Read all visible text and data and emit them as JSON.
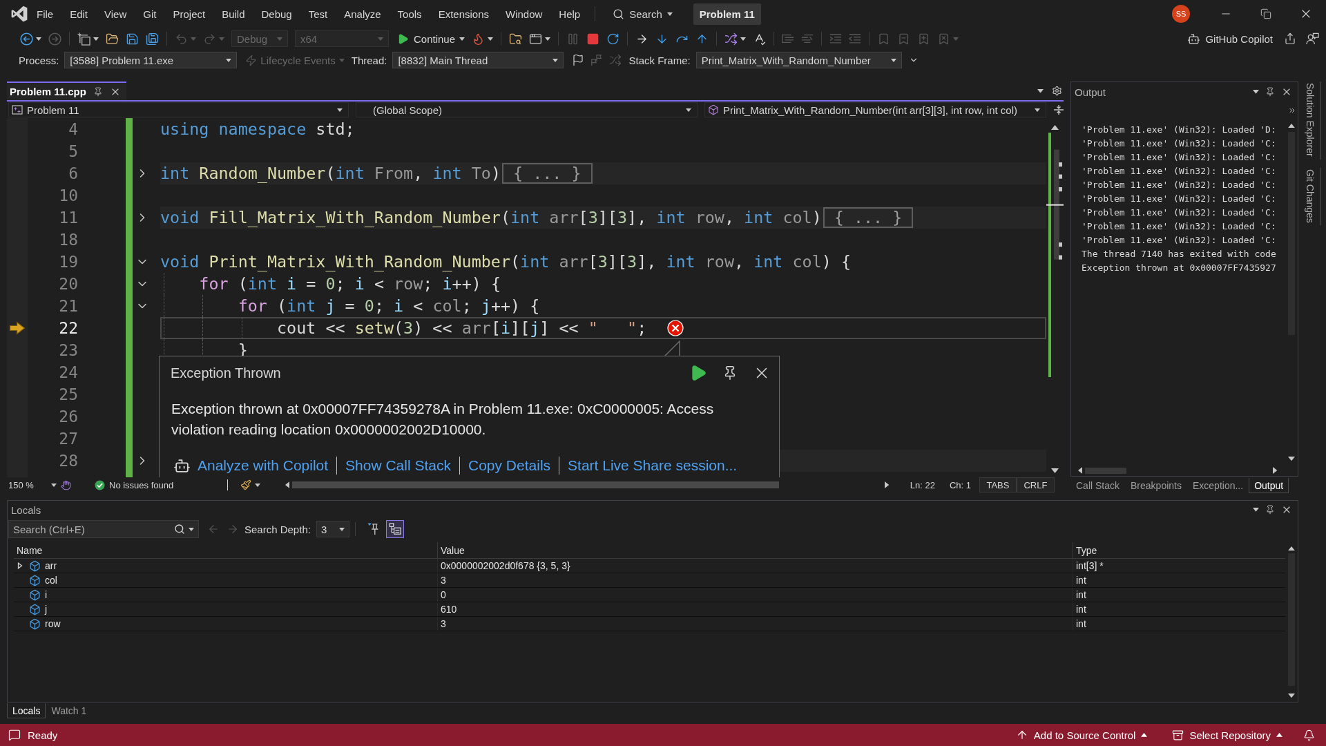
{
  "menu_bar": {
    "items": [
      "File",
      "Edit",
      "View",
      "Git",
      "Project",
      "Build",
      "Debug",
      "Test",
      "Analyze",
      "Tools",
      "Extensions",
      "Window",
      "Help"
    ],
    "search": "Search",
    "solution": "Problem 11",
    "avatar": "SS"
  },
  "toolbar": {
    "groups": [
      [
        {
          "kind": "back",
          "disabled": false
        },
        {
          "kind": "forward",
          "disabled": true
        }
      ],
      [
        {
          "kind": "new-item",
          "disabled": false
        },
        {
          "kind": "open",
          "disabled": false
        },
        {
          "kind": "save",
          "disabled": false
        },
        {
          "kind": "save-all",
          "disabled": false
        }
      ],
      [
        {
          "kind": "undo",
          "disabled": true
        },
        {
          "kind": "redo",
          "disabled": true
        },
        {
          "kind": "combo",
          "value": "Debug",
          "disabled": true
        },
        {
          "kind": "combo",
          "value": "x64",
          "disabled": true
        },
        {
          "kind": "continue",
          "label": "Continue",
          "disabled": false
        },
        {
          "kind": "hot-reload",
          "disabled": false
        }
      ],
      [
        {
          "kind": "folder-search",
          "disabled": false
        },
        {
          "kind": "browser",
          "disabled": false
        }
      ],
      [
        {
          "kind": "pause",
          "disabled": true
        },
        {
          "kind": "stop",
          "disabled": false
        },
        {
          "kind": "restart",
          "disabled": false
        }
      ],
      [
        {
          "kind": "next-statement",
          "disabled": false
        },
        {
          "kind": "step-into",
          "disabled": false
        },
        {
          "kind": "step-over",
          "disabled": false
        },
        {
          "kind": "step-out",
          "disabled": false
        }
      ],
      [
        {
          "kind": "hot-swap",
          "disabled": false
        },
        {
          "kind": "spell-check",
          "disabled": false
        }
      ],
      [
        {
          "kind": "comment",
          "disabled": true
        },
        {
          "kind": "uncomment",
          "disabled": true
        }
      ],
      [
        {
          "kind": "indent",
          "disabled": true
        },
        {
          "kind": "outdent",
          "disabled": true
        }
      ],
      [
        {
          "kind": "bookmark",
          "disabled": true
        },
        {
          "kind": "bookmark-previous",
          "disabled": true
        },
        {
          "kind": "bookmark-next",
          "disabled": true
        },
        {
          "kind": "bookmark-clear",
          "disabled": true
        }
      ]
    ],
    "copilot": "GitHub Copilot"
  },
  "debug_location": {
    "process_label": "Process:",
    "process": "[3588] Problem 11.exe",
    "lifecycle": {
      "label": "Lifecycle Events",
      "disabled": true
    },
    "thread_label": "Thread:",
    "thread": "[8832] Main Thread",
    "thread_tools": [
      {
        "kind": "flag",
        "disabled": false
      },
      {
        "kind": "flag-threads",
        "disabled": true
      },
      {
        "kind": "parallel",
        "disabled": true
      }
    ],
    "stack_frame_label": "Stack Frame:",
    "stack_frame": "Print_Matrix_With_Random_Number"
  },
  "document_tabs": [
    {
      "label": "Problem 11.cpp",
      "selected": true
    }
  ],
  "navigation_bar": {
    "project": "Problem 11",
    "scope": "(Global Scope)",
    "member": "Print_Matrix_With_Random_Number(int arr[3][3], int row, int col)"
  },
  "editor": {
    "lines": [
      {
        "number": "4",
        "kind": "plain",
        "current": false,
        "exception": false,
        "tokens": [
          {
            "kind": "keyword",
            "text": "using "
          },
          {
            "kind": "keyword",
            "text": "namespace"
          },
          {
            "kind": "plain",
            "text": " std;"
          }
        ]
      },
      {
        "number": "5",
        "kind": "plain",
        "current": false,
        "exception": false
      },
      {
        "number": "6",
        "kind": "collapsed",
        "current": false,
        "exception": false,
        "tokens": [
          {
            "kind": "keyword",
            "text": "int "
          },
          {
            "kind": "function",
            "text": "Random_Number"
          },
          {
            "kind": "plain",
            "text": "("
          },
          {
            "kind": "keyword",
            "text": "int "
          },
          {
            "kind": "parameter",
            "text": "From"
          },
          {
            "kind": "plain",
            "text": ", "
          },
          {
            "kind": "keyword",
            "text": "int "
          },
          {
            "kind": "parameter",
            "text": "To"
          },
          {
            "kind": "plain",
            "text": ")"
          }
        ],
        "collapsed_text": "{ ... }"
      },
      {
        "number": "10",
        "kind": "plain",
        "current": false,
        "exception": false
      },
      {
        "number": "11",
        "kind": "collapsed",
        "current": false,
        "exception": false,
        "tokens": [
          {
            "kind": "keyword",
            "text": "void "
          },
          {
            "kind": "function",
            "text": "Fill_Matrix_With_Random_Number"
          },
          {
            "kind": "plain",
            "text": "("
          },
          {
            "kind": "keyword",
            "text": "int "
          },
          {
            "kind": "parameter",
            "text": "arr"
          },
          {
            "kind": "plain",
            "text": "["
          },
          {
            "kind": "number",
            "text": "3"
          },
          {
            "kind": "plain",
            "text": "]["
          },
          {
            "kind": "number",
            "text": "3"
          },
          {
            "kind": "plain",
            "text": "], "
          },
          {
            "kind": "keyword",
            "text": "int "
          },
          {
            "kind": "parameter",
            "text": "row"
          },
          {
            "kind": "plain",
            "text": ", "
          },
          {
            "kind": "keyword",
            "text": "int "
          },
          {
            "kind": "parameter",
            "text": "col"
          },
          {
            "kind": "plain",
            "text": ")"
          }
        ],
        "collapsed_text": "{ ... }"
      },
      {
        "number": "18",
        "kind": "plain",
        "current": false,
        "exception": false
      },
      {
        "number": "19",
        "kind": "expanded",
        "current": false,
        "exception": false,
        "tokens": [
          {
            "kind": "keyword",
            "text": "void "
          },
          {
            "kind": "function",
            "text": "Print_Matrix_With_Random_Number"
          },
          {
            "kind": "plain",
            "text": "("
          },
          {
            "kind": "keyword",
            "text": "int "
          },
          {
            "kind": "parameter",
            "text": "arr"
          },
          {
            "kind": "plain",
            "text": "["
          },
          {
            "kind": "number",
            "text": "3"
          },
          {
            "kind": "plain",
            "text": "]["
          },
          {
            "kind": "number",
            "text": "3"
          },
          {
            "kind": "plain",
            "text": "], "
          },
          {
            "kind": "keyword",
            "text": "int "
          },
          {
            "kind": "parameter",
            "text": "row"
          },
          {
            "kind": "plain",
            "text": ", "
          },
          {
            "kind": "keyword",
            "text": "int "
          },
          {
            "kind": "parameter",
            "text": "col"
          },
          {
            "kind": "plain",
            "text": ") {"
          }
        ]
      },
      {
        "number": "20",
        "kind": "expanded",
        "current": false,
        "exception": false,
        "tokens": [
          {
            "kind": "control",
            "text": "\tfor"
          },
          {
            "kind": "plain",
            "text": " ("
          },
          {
            "kind": "keyword",
            "text": "int "
          },
          {
            "kind": "local",
            "text": "i"
          },
          {
            "kind": "plain",
            "text": " = "
          },
          {
            "kind": "number",
            "text": "0"
          },
          {
            "kind": "plain",
            "text": "; "
          },
          {
            "kind": "local",
            "text": "i"
          },
          {
            "kind": "plain",
            "text": " < "
          },
          {
            "kind": "parameter",
            "text": "row"
          },
          {
            "kind": "plain",
            "text": "; "
          },
          {
            "kind": "local",
            "text": "i"
          },
          {
            "kind": "plain",
            "text": "++) {"
          }
        ]
      },
      {
        "number": "21",
        "kind": "expanded",
        "current": false,
        "exception": false,
        "tokens": [
          {
            "kind": "control",
            "text": "\t\tfor"
          },
          {
            "kind": "plain",
            "text": " ("
          },
          {
            "kind": "keyword",
            "text": "int "
          },
          {
            "kind": "local",
            "text": "j"
          },
          {
            "kind": "plain",
            "text": " = "
          },
          {
            "kind": "number",
            "text": "0"
          },
          {
            "kind": "plain",
            "text": "; "
          },
          {
            "kind": "local",
            "text": "i"
          },
          {
            "kind": "plain",
            "text": " < "
          },
          {
            "kind": "parameter",
            "text": "col"
          },
          {
            "kind": "plain",
            "text": "; "
          },
          {
            "kind": "local",
            "text": "j"
          },
          {
            "kind": "plain",
            "text": "++) {"
          }
        ]
      },
      {
        "number": "22",
        "kind": "plain",
        "current": true,
        "exception": true,
        "tokens": [
          {
            "kind": "plain",
            "text": "\t\t\tcout << "
          },
          {
            "kind": "function",
            "text": "setw"
          },
          {
            "kind": "plain",
            "text": "("
          },
          {
            "kind": "number",
            "text": "3"
          },
          {
            "kind": "plain",
            "text": ") << "
          },
          {
            "kind": "parameter",
            "text": "arr"
          },
          {
            "kind": "plain",
            "text": "["
          },
          {
            "kind": "local",
            "text": "i"
          },
          {
            "kind": "plain",
            "text": "]["
          },
          {
            "kind": "local",
            "text": "j"
          },
          {
            "kind": "plain",
            "text": "] << "
          },
          {
            "kind": "string",
            "text": "\"   \""
          },
          {
            "kind": "plain",
            "text": ";"
          }
        ]
      },
      {
        "number": "23",
        "kind": "plain",
        "current": false,
        "exception": false,
        "tokens": [
          {
            "kind": "plain",
            "text": "\t\t}"
          }
        ]
      },
      {
        "number": "24",
        "kind": "plain",
        "current": false,
        "exception": false
      },
      {
        "number": "25",
        "kind": "plain",
        "current": false,
        "exception": false
      },
      {
        "number": "26",
        "kind": "plain",
        "current": false,
        "exception": false
      },
      {
        "number": "27",
        "kind": "plain",
        "current": false,
        "exception": false
      },
      {
        "number": "28",
        "kind": "collapsed",
        "current": false,
        "exception": false
      }
    ],
    "exception_popup": {
      "title": "Exception Thrown",
      "message": "Exception thrown at 0x00007FF74359278A in Problem 11.exe: 0xC0000005: Access violation reading location 0x0000002002D10000.",
      "links": [
        {
          "kind": "copilot",
          "label": "Analyze with Copilot"
        },
        {
          "kind": "link",
          "label": "Show Call Stack"
        },
        {
          "kind": "link",
          "label": "Copy Details"
        },
        {
          "kind": "link",
          "label": "Start Live Share session..."
        }
      ]
    },
    "status": {
      "zoom": "150 %",
      "issues": "No issues found",
      "line": "Ln: 22",
      "column": "Ch: 1",
      "indentation": "TABS",
      "line_endings": "CRLF"
    }
  },
  "output_panel": {
    "title": "Output",
    "lines": [
      "'Problem 11.exe' (Win32): Loaded 'D:",
      "'Problem 11.exe' (Win32): Loaded 'C:",
      "'Problem 11.exe' (Win32): Loaded 'C:",
      "'Problem 11.exe' (Win32): Loaded 'C:",
      "'Problem 11.exe' (Win32): Loaded 'C:",
      "'Problem 11.exe' (Win32): Loaded 'C:",
      "'Problem 11.exe' (Win32): Loaded 'C:",
      "'Problem 11.exe' (Win32): Loaded 'C:",
      "'Problem 11.exe' (Win32): Loaded 'C:",
      "The thread 7140 has exited with code",
      "Exception thrown at 0x00007FF7435927"
    ]
  },
  "right_panel_tabs": [
    {
      "label": "Call Stack",
      "selected": false
    },
    {
      "label": "Breakpoints",
      "selected": false
    },
    {
      "label": "Exception...",
      "selected": false
    },
    {
      "label": "Output",
      "selected": true
    }
  ],
  "side_tabs": [
    "Solution Explorer",
    "Git Changes"
  ],
  "locals": {
    "title": "Locals",
    "search_placeholder": "Search (Ctrl+E)",
    "navigation": [
      {
        "kind": "back",
        "disabled": true
      },
      {
        "kind": "forward",
        "disabled": true
      }
    ],
    "search_depth_label": "Search Depth:",
    "search_depth": "3",
    "toggles": [
      {
        "kind": "pin-filter",
        "on": false
      },
      {
        "kind": "tree-view",
        "on": true
      }
    ],
    "columns": [
      "Name",
      "Value",
      "Type"
    ],
    "rows": [
      {
        "kind": "expandable",
        "name": "arr",
        "value": "0x0000002002d0f678 {3, 5, 3}",
        "type": "int[3] *",
        "expanded": false
      },
      {
        "kind": "leaf",
        "name": "col",
        "value": "3",
        "type": "int"
      },
      {
        "kind": "leaf",
        "name": "i",
        "value": "0",
        "type": "int"
      },
      {
        "kind": "leaf",
        "name": "j",
        "value": "610",
        "type": "int"
      },
      {
        "kind": "leaf",
        "name": "row",
        "value": "3",
        "type": "int"
      }
    ]
  },
  "locals_tabs": [
    {
      "label": "Locals",
      "selected": true
    },
    {
      "label": "Watch 1",
      "selected": false
    }
  ],
  "status_bar": {
    "message": "Ready",
    "source_control": "Add to Source Control",
    "repository": "Select Repository"
  }
}
